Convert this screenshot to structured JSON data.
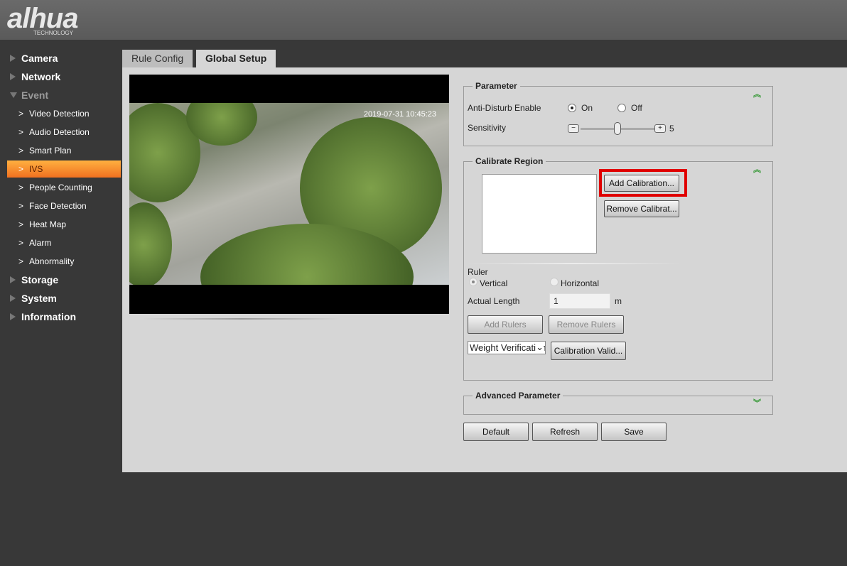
{
  "header": {
    "logo": "alhua",
    "logo_sub": "TECHNOLOGY"
  },
  "sidebar": {
    "top": [
      {
        "label": "Camera"
      },
      {
        "label": "Network"
      },
      {
        "label": "Event"
      },
      {
        "label": "Storage"
      },
      {
        "label": "System"
      },
      {
        "label": "Information"
      }
    ],
    "event_items": [
      {
        "label": "Video Detection"
      },
      {
        "label": "Audio Detection"
      },
      {
        "label": "Smart Plan"
      },
      {
        "label": "IVS"
      },
      {
        "label": "People Counting"
      },
      {
        "label": "Face Detection"
      },
      {
        "label": "Heat Map"
      },
      {
        "label": "Alarm"
      },
      {
        "label": "Abnormality"
      }
    ],
    "active": "IVS"
  },
  "tabs": [
    {
      "label": "Rule Config"
    },
    {
      "label": "Global Setup"
    }
  ],
  "video": {
    "timestamp": "2019-07-31 10:45:23"
  },
  "parameter": {
    "title": "Parameter",
    "anti_disturb_label": "Anti-Disturb Enable",
    "on_label": "On",
    "off_label": "Off",
    "anti_disturb": "On",
    "sensitivity_label": "Sensitivity",
    "sensitivity": "5",
    "sensitivity_max": 10
  },
  "calibrate": {
    "title": "Calibrate Region",
    "add_btn": "Add Calibration...",
    "remove_btn": "Remove Calibrat...",
    "ruler_label": "Ruler",
    "vertical_label": "Vertical",
    "horizontal_label": "Horizontal",
    "ruler": "Vertical",
    "length_label": "Actual Length",
    "length_value": "1",
    "unit": "m",
    "add_rulers": "Add Rulers",
    "remove_rulers": "Remove Rulers",
    "verify_select": "Weight Verification",
    "validate_btn": "Calibration Valid..."
  },
  "advanced": {
    "title": "Advanced Parameter"
  },
  "footer": {
    "default": "Default",
    "refresh": "Refresh",
    "save": "Save"
  },
  "colors": {
    "highlight": "#e00000",
    "active": "#f58a2a"
  }
}
